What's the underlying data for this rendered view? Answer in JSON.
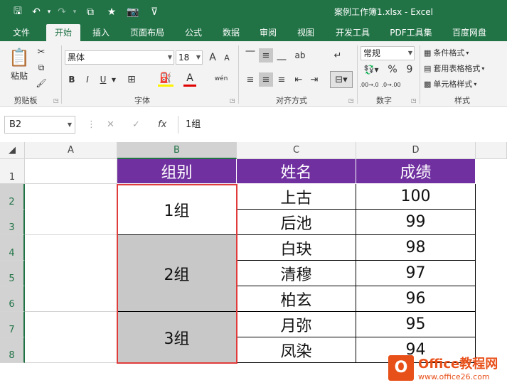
{
  "title": "案例工作簿1.xlsx - Excel",
  "qat": {
    "save": "🖫",
    "undo": "↶",
    "undo_dd": "▾",
    "redo": "↷",
    "redo_dd": "▾",
    "b1": "⧉",
    "b2": "★",
    "b3": "📷",
    "more": "⊽"
  },
  "tabs": [
    "文件",
    "开始",
    "插入",
    "页面布局",
    "公式",
    "数据",
    "审阅",
    "视图",
    "开发工具",
    "PDF工具集",
    "百度网盘"
  ],
  "ribbon": {
    "groups": [
      "剪贴板",
      "字体",
      "对齐方式",
      "数字",
      "样式"
    ],
    "paste": "粘贴",
    "font_name": "黑体",
    "font_size": "18",
    "bold": "B",
    "italic": "I",
    "underline": "U",
    "number_format": "常规",
    "percent": "%",
    "comma": "9",
    "cond_format": "条件格式",
    "table_format": "套用表格格式",
    "cell_style": "单元格样式",
    "grow_font": "A",
    "shrink_font": "A",
    "wen": "wén",
    "inc_dec": ".00→.0",
    "dec_dec": ".0→.00"
  },
  "formula_bar": {
    "name_box": "B2",
    "fx": "fx",
    "cancel": "✕",
    "enter": "✓",
    "formula": "1组"
  },
  "columns": [
    "A",
    "B",
    "C",
    "D"
  ],
  "rows": [
    "1",
    "2",
    "3",
    "4",
    "5",
    "6",
    "7",
    "8"
  ],
  "table": {
    "headers": [
      "组别",
      "姓名",
      "成绩"
    ],
    "groups": [
      "1组",
      "2组",
      "3组"
    ],
    "names": [
      "上古",
      "后池",
      "白玦",
      "清穆",
      "柏玄",
      "月弥",
      "凤染"
    ],
    "scores": [
      "100",
      "99",
      "98",
      "97",
      "96",
      "95",
      "94"
    ]
  },
  "watermark": {
    "brand": "Office教程网",
    "url": "www.office26.com",
    "logo": "O"
  },
  "colors": {
    "excel_green": "#217346",
    "header_purple": "#7030a0",
    "selection_red": "#e03c3c",
    "merged_gray": "#c8c8c8"
  }
}
